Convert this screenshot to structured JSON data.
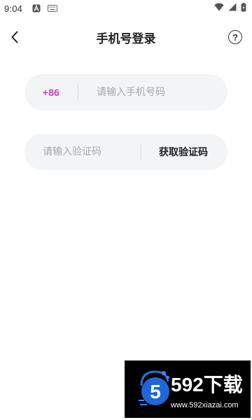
{
  "status_bar": {
    "time": "9:04"
  },
  "header": {
    "title": "手机号登录",
    "help_label": "?"
  },
  "phone_field": {
    "country_code": "+86",
    "placeholder": "请输入手机号码",
    "value": ""
  },
  "code_field": {
    "placeholder": "请输入验证码",
    "value": "",
    "get_code_label": "获取验证码"
  },
  "colors": {
    "country_code": "#cc3fc1",
    "field_background": "#f3f4f6",
    "placeholder": "#a7a7a7"
  },
  "watermark": {
    "logo_digit": "5",
    "brand": "592下载",
    "url": "www.592xiazai.com"
  }
}
